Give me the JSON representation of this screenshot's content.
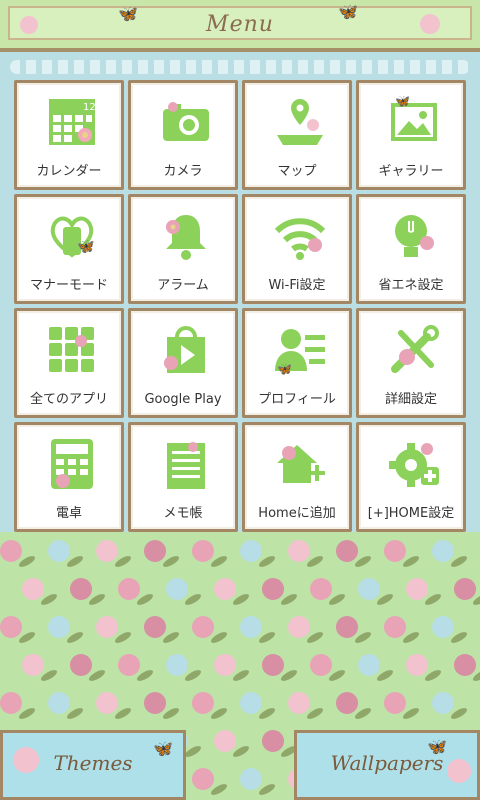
{
  "header": {
    "title": "Menu"
  },
  "grid": {
    "items": [
      {
        "label": "カレンダー",
        "icon": "calendar-icon",
        "badge": "12"
      },
      {
        "label": "カメラ",
        "icon": "camera-icon"
      },
      {
        "label": "マップ",
        "icon": "map-icon"
      },
      {
        "label": "ギャラリー",
        "icon": "gallery-icon"
      },
      {
        "label": "マナーモード",
        "icon": "manner-mode-icon"
      },
      {
        "label": "アラーム",
        "icon": "alarm-bell-icon"
      },
      {
        "label": "Wi-Fi設定",
        "icon": "wifi-icon"
      },
      {
        "label": "省エネ設定",
        "icon": "power-saving-icon"
      },
      {
        "label": "全てのアプリ",
        "icon": "all-apps-icon"
      },
      {
        "label": "Google Play",
        "icon": "google-play-icon"
      },
      {
        "label": "プロフィール",
        "icon": "profile-icon"
      },
      {
        "label": "詳細設定",
        "icon": "detailed-settings-icon"
      },
      {
        "label": "電卓",
        "icon": "calculator-icon"
      },
      {
        "label": "メモ帳",
        "icon": "notepad-icon"
      },
      {
        "label": "Homeに追加",
        "icon": "add-home-icon"
      },
      {
        "label": "[+]HOME設定",
        "icon": "home-settings-gear-icon"
      }
    ]
  },
  "bottom": {
    "themes_label": "Themes",
    "wallpapers_label": "Wallpapers"
  },
  "colors": {
    "icon_green": "#8cd15a",
    "tile_border": "#a38663",
    "header_bg": "#c8e6a8",
    "floral_bg": "#bde3a6",
    "button_bg": "#aee0ea"
  }
}
